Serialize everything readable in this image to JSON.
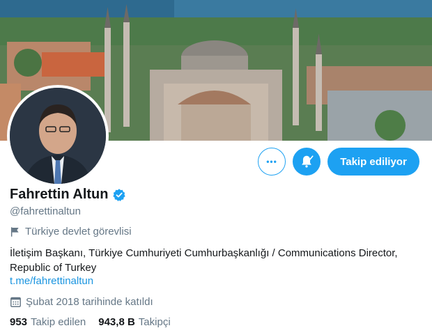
{
  "profile": {
    "display_name": "Fahrettin Altun",
    "handle": "@fahrettinaltun",
    "category": "Türkiye devlet görevlisi",
    "bio": "İletişim Başkanı, Türkiye Cumhuriyeti Cumhurbaşkanlığı / Communications Director, Republic of Turkey",
    "link": "t.me/fahrettinaltun",
    "joined": "Şubat 2018 tarihinde katıldı",
    "following_count": "953",
    "following_label": "Takip edilen",
    "followers_count": "943,8 B",
    "followers_label": "Takipçi"
  },
  "actions": {
    "more_label": "•••",
    "follow_label": "Takip ediliyor"
  },
  "icons": {
    "verified": "verified-badge-icon",
    "category": "flag-icon",
    "joined": "calendar-icon",
    "more": "more-icon",
    "bell": "bell-check-icon"
  },
  "colors": {
    "accent": "#1da1f2",
    "link": "#1b95e0",
    "secondary_text": "#657786",
    "primary_text": "#14171a"
  }
}
